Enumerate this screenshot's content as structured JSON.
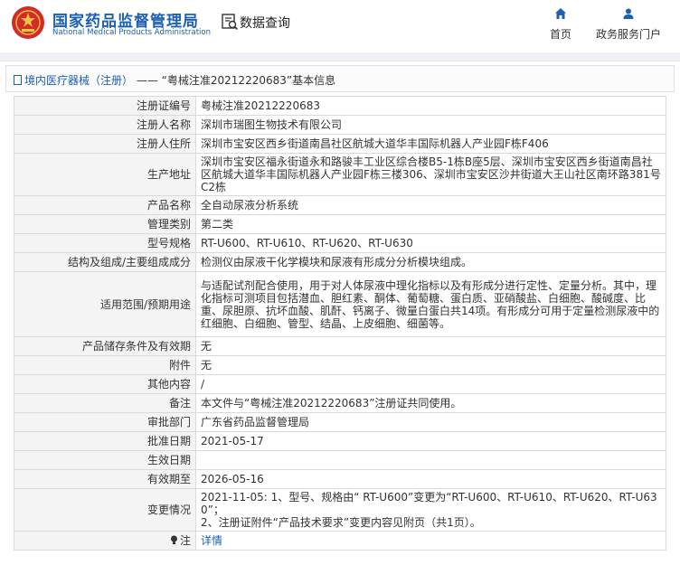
{
  "header": {
    "brand_cn": "国家药品监督管理局",
    "brand_en": "National Medical Products Administration",
    "query_title": "数据查询",
    "nav_home": "首页",
    "nav_gov": "政务服务门户",
    "brand_color": "#1d5fb0",
    "logo_color": "#d32a2a"
  },
  "breadcrumb": {
    "category": "境内医疗器械（注册）",
    "separator": "——",
    "record": "“粤械注准20212220683”基本信息"
  },
  "fields": [
    {
      "label": "注册证编号",
      "value": "粤械注准20212220683"
    },
    {
      "label": "注册人名称",
      "value": "深圳市瑞图生物技术有限公司"
    },
    {
      "label": "注册人住所",
      "value": "深圳市宝安区西乡街道南昌社区航城大道华丰国际机器人产业园F栋F406"
    },
    {
      "label": "生产地址",
      "value": "深圳市宝安区福永街道永和路骏丰工业区综合楼B5-1栋B座5层、深圳市宝安区西乡街道南昌社区航城大道华丰国际机器人产业园F栋三楼306、深圳市宝安区沙井街道大王山社区南环路381号C2栋"
    },
    {
      "label": "产品名称",
      "value": "全自动尿液分析系统"
    },
    {
      "label": "管理类别",
      "value": "第二类"
    },
    {
      "label": "型号规格",
      "value": "RT-U600、RT-U610、RT-U620、RT-U630"
    },
    {
      "label": "结构及组成/主要组成成分",
      "value": "检测仪由尿液干化学模块和尿液有形成分分析模块组成。"
    },
    {
      "label": "适用范围/预期用途",
      "value": "与适配试剂配合使用，用于对人体尿液中理化指标以及有形成分进行定性、定量分析。其中，理化指标可测项目包括潜血、胆红素、酮体、葡萄糖、蛋白质、亚硝酸盐、白细胞、酸碱度、比重、尿胆原、抗坏血酸、肌酐、钙离子、微量白蛋白共14项。有形成分可用于定量检测尿液中的红细胞、白细胞、管型、结晶、上皮细胞、细菌等。"
    },
    {
      "label": "产品储存条件及有效期",
      "value": "无"
    },
    {
      "label": "附件",
      "value": "无"
    },
    {
      "label": "其他内容",
      "value": "/"
    },
    {
      "label": "备注",
      "value": "本文件与“粤械注准20212220683”注册证共同使用。"
    },
    {
      "label": "审批部门",
      "value": "广东省药品监督管理局"
    },
    {
      "label": "批准日期",
      "value": "2021-05-17"
    },
    {
      "label": "生效日期",
      "value": ""
    },
    {
      "label": "有效期至",
      "value": "2026-05-16"
    },
    {
      "label": "变更情况",
      "value": "2021-11-05: 1、型号、规格由“ RT-U600”变更为“RT-U600、RT-U610、RT-U620、RT-U630”；\n2、注册证附件“产品技术要求”变更内容见附页（共1页）。"
    }
  ],
  "note": {
    "label": "注",
    "link": "详情"
  }
}
